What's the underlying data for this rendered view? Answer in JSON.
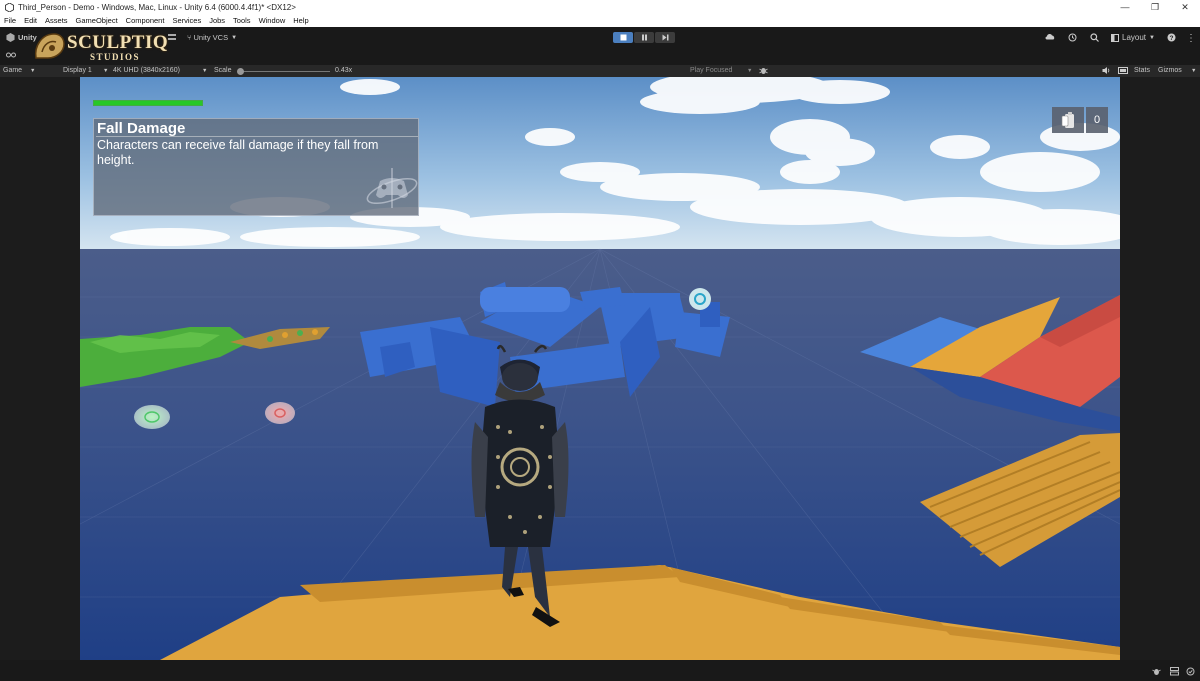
{
  "window": {
    "title": "Third_Person - Demo - Windows, Mac, Linux - Unity 6.4 (6000.4.4f1)* <DX12>",
    "minimize": "—",
    "maximize": "❐",
    "close": "✕"
  },
  "menu": [
    "File",
    "Edit",
    "Assets",
    "GameObject",
    "Component",
    "Services",
    "Jobs",
    "Tools",
    "Window",
    "Help"
  ],
  "toolbar": {
    "account": "Unity",
    "unity_vcs": "Unity VCS",
    "layout": "Layout"
  },
  "watermark": {
    "line1": "SCULPTIQ",
    "line2": "STUDIOS"
  },
  "gamebar": {
    "view": "Game",
    "display": "Display 1",
    "resolution": "4K UHD (3840x2160)",
    "scale_label": "Scale",
    "scale_value": "0.43x",
    "play_mode": "Play Focused",
    "stats": "Stats",
    "gizmos": "Gizmos"
  },
  "hud": {
    "title": "Fall Damage",
    "description": "Characters can receive fall damage if they fall from height.",
    "health_fraction": 1.0,
    "counter": "0"
  },
  "colors": {
    "accent": "#4b7fbf",
    "health": "#27c827",
    "stairs": "#dba23a",
    "maze": "#3a6fd0",
    "red_ramp": "#d9534a"
  }
}
